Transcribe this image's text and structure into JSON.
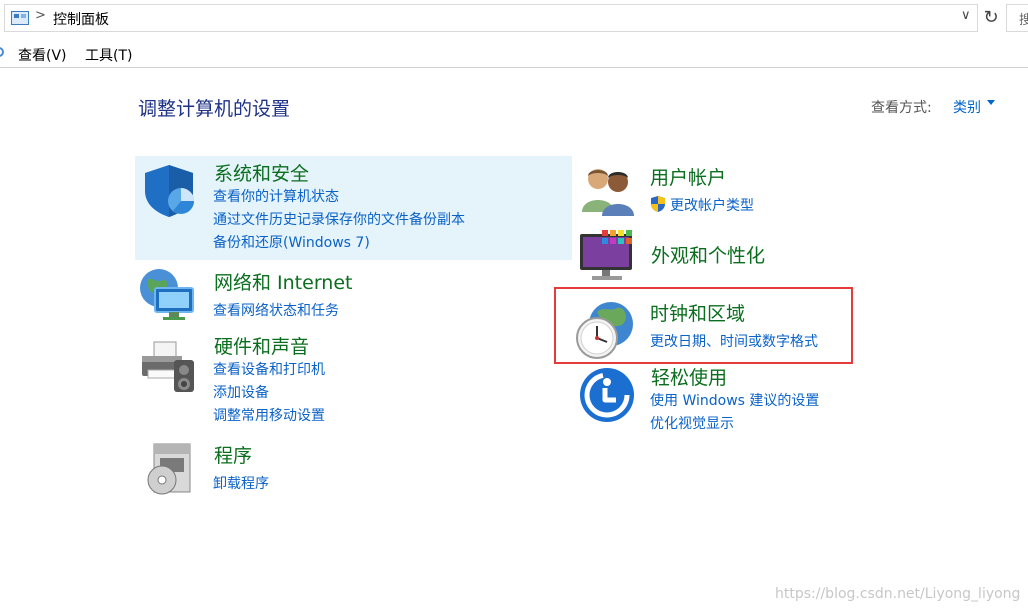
{
  "address_bar": {
    "sep": ">",
    "path": "控制面板",
    "refresh_glyph": "↻",
    "dropdown_glyph": "∨",
    "search_stub": "搜"
  },
  "menu": {
    "view": "查看(V)",
    "tools": "工具(T)"
  },
  "header": {
    "title": "调整计算机的设置",
    "view_by_label": "查看方式:",
    "view_by_value": "类别"
  },
  "categories": {
    "system_security": {
      "title": "系统和安全",
      "links": [
        "查看你的计算机状态",
        "通过文件历史记录保存你的文件备份副本",
        "备份和还原(Windows 7)"
      ],
      "icon": "shield-icon"
    },
    "network": {
      "title": "网络和 Internet",
      "links": [
        "查看网络状态和任务"
      ],
      "icon": "network-globe-icon"
    },
    "hardware": {
      "title": "硬件和声音",
      "links": [
        "查看设备和打印机",
        "添加设备",
        "调整常用移动设置"
      ],
      "icon": "printer-icon"
    },
    "programs": {
      "title": "程序",
      "links": [
        "卸载程序"
      ],
      "icon": "programs-disc-icon"
    },
    "user_accounts": {
      "title": "用户帐户",
      "links": [
        "更改帐户类型"
      ],
      "icon": "users-icon"
    },
    "appearance": {
      "title": "外观和个性化",
      "links": [],
      "icon": "monitor-colors-icon"
    },
    "clock_region": {
      "title": "时钟和区域",
      "links": [
        "更改日期、时间或数字格式"
      ],
      "icon": "clock-globe-icon"
    },
    "ease_of_access": {
      "title": "轻松使用",
      "links": [
        "使用 Windows 建议的设置",
        "优化视觉显示"
      ],
      "icon": "ease-of-access-icon"
    }
  },
  "colors": {
    "title_green": "#0b6e1e",
    "link_blue": "#0b62c7",
    "highlight": "#e5f3fb",
    "annotation_red": "#e53b3b"
  },
  "watermark": "https://blog.csdn.net/Liyong_liyong"
}
